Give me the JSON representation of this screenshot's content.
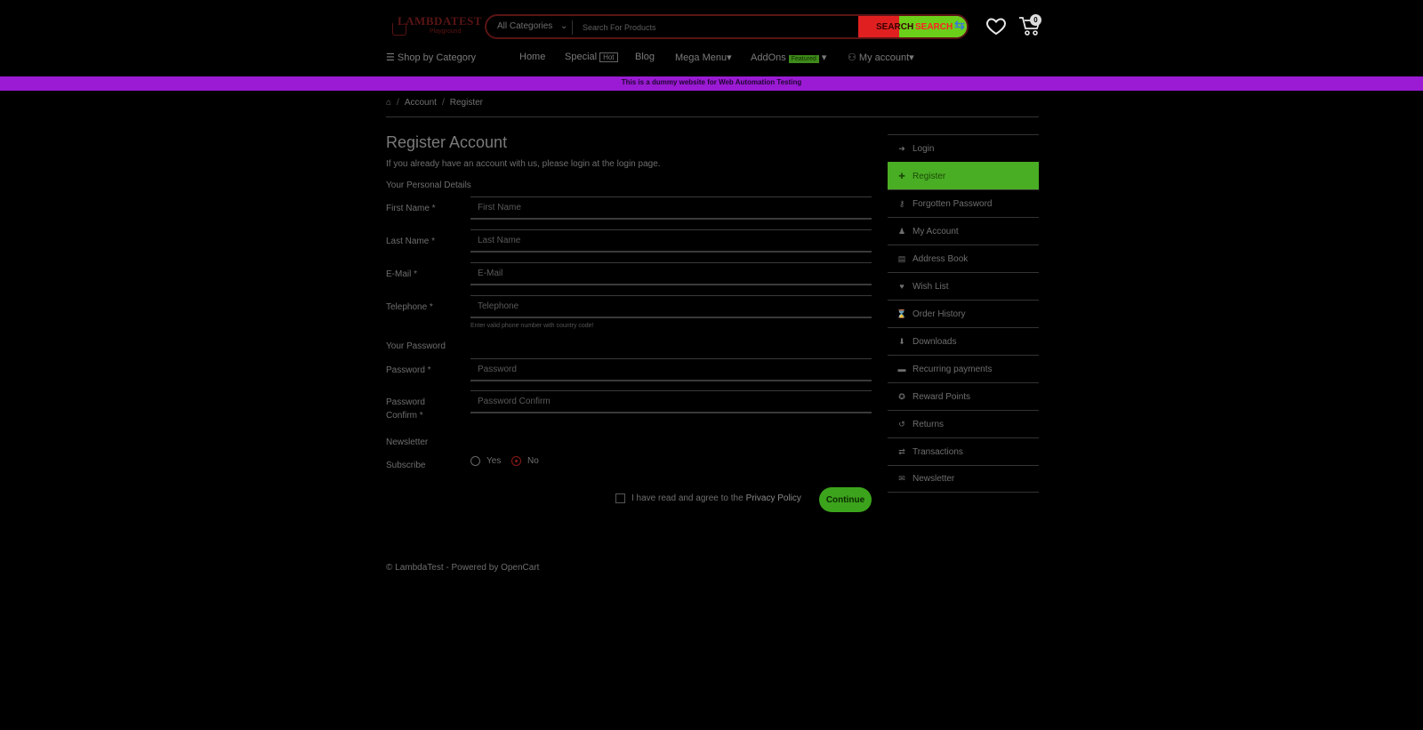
{
  "header": {
    "logo_line1": "LAMBDATEST",
    "logo_line2": "Playground",
    "category_select": "All Categories",
    "search_placeholder": "Search For Products",
    "search_button_text_1": "SEARCH",
    "search_button_text_2": "SEARCH",
    "cart_count": "0",
    "colors": {
      "search_red": "#e02020",
      "search_green": "#6bcf1a",
      "promo_bar": "#9b1ad4"
    }
  },
  "nav": {
    "shop_by_category": "Shop by Category",
    "home": "Home",
    "special": "Special",
    "hot_badge": "Hot",
    "blog": "Blog",
    "mega_menu": "Mega Menu",
    "addons": "AddOns",
    "featured_badge": "Featured",
    "my_account": "My account"
  },
  "promo_text": "This is a dummy website for Web Automation Testing",
  "breadcrumb": {
    "account": "Account",
    "register": "Register"
  },
  "form": {
    "title": "Register Account",
    "intro": "If you already have an account with us, please login at the login page.",
    "personal_legend": "Your Personal Details",
    "first_name_label": "First Name *",
    "first_name_placeholder": "First Name",
    "last_name_label": "Last Name *",
    "last_name_placeholder": "Last Name",
    "email_label": "E-Mail *",
    "email_placeholder": "E-Mail",
    "telephone_label": "Telephone *",
    "telephone_placeholder": "Telephone",
    "telephone_help": "Enter valid phone number with country code!",
    "password_legend": "Your Password",
    "password_label": "Password *",
    "password_placeholder": "Password",
    "confirm_label": "Password Confirm *",
    "confirm_placeholder": "Password Confirm",
    "newsletter_legend": "Newsletter",
    "subscribe_label": "Subscribe",
    "yes": "Yes",
    "no": "No",
    "selected": "No",
    "agree_text": "I have read and agree to the",
    "privacy_policy": "Privacy Policy",
    "continue": "Continue"
  },
  "sidebar": {
    "items": [
      {
        "label": "Login",
        "icon": "sign-in-icon"
      },
      {
        "label": "Register",
        "icon": "user-plus-icon",
        "active": true
      },
      {
        "label": "Forgotten Password",
        "icon": "key-icon"
      },
      {
        "label": "My Account",
        "icon": "user-icon"
      },
      {
        "label": "Address Book",
        "icon": "address-book-icon"
      },
      {
        "label": "Wish List",
        "icon": "heart-icon"
      },
      {
        "label": "Order History",
        "icon": "history-icon"
      },
      {
        "label": "Downloads",
        "icon": "download-icon"
      },
      {
        "label": "Recurring payments",
        "icon": "credit-card-icon"
      },
      {
        "label": "Reward Points",
        "icon": "medal-icon"
      },
      {
        "label": "Returns",
        "icon": "undo-icon"
      },
      {
        "label": "Transactions",
        "icon": "exchange-icon"
      },
      {
        "label": "Newsletter",
        "icon": "envelope-icon"
      }
    ]
  },
  "footer": "© LambdaTest - Powered by OpenCart"
}
